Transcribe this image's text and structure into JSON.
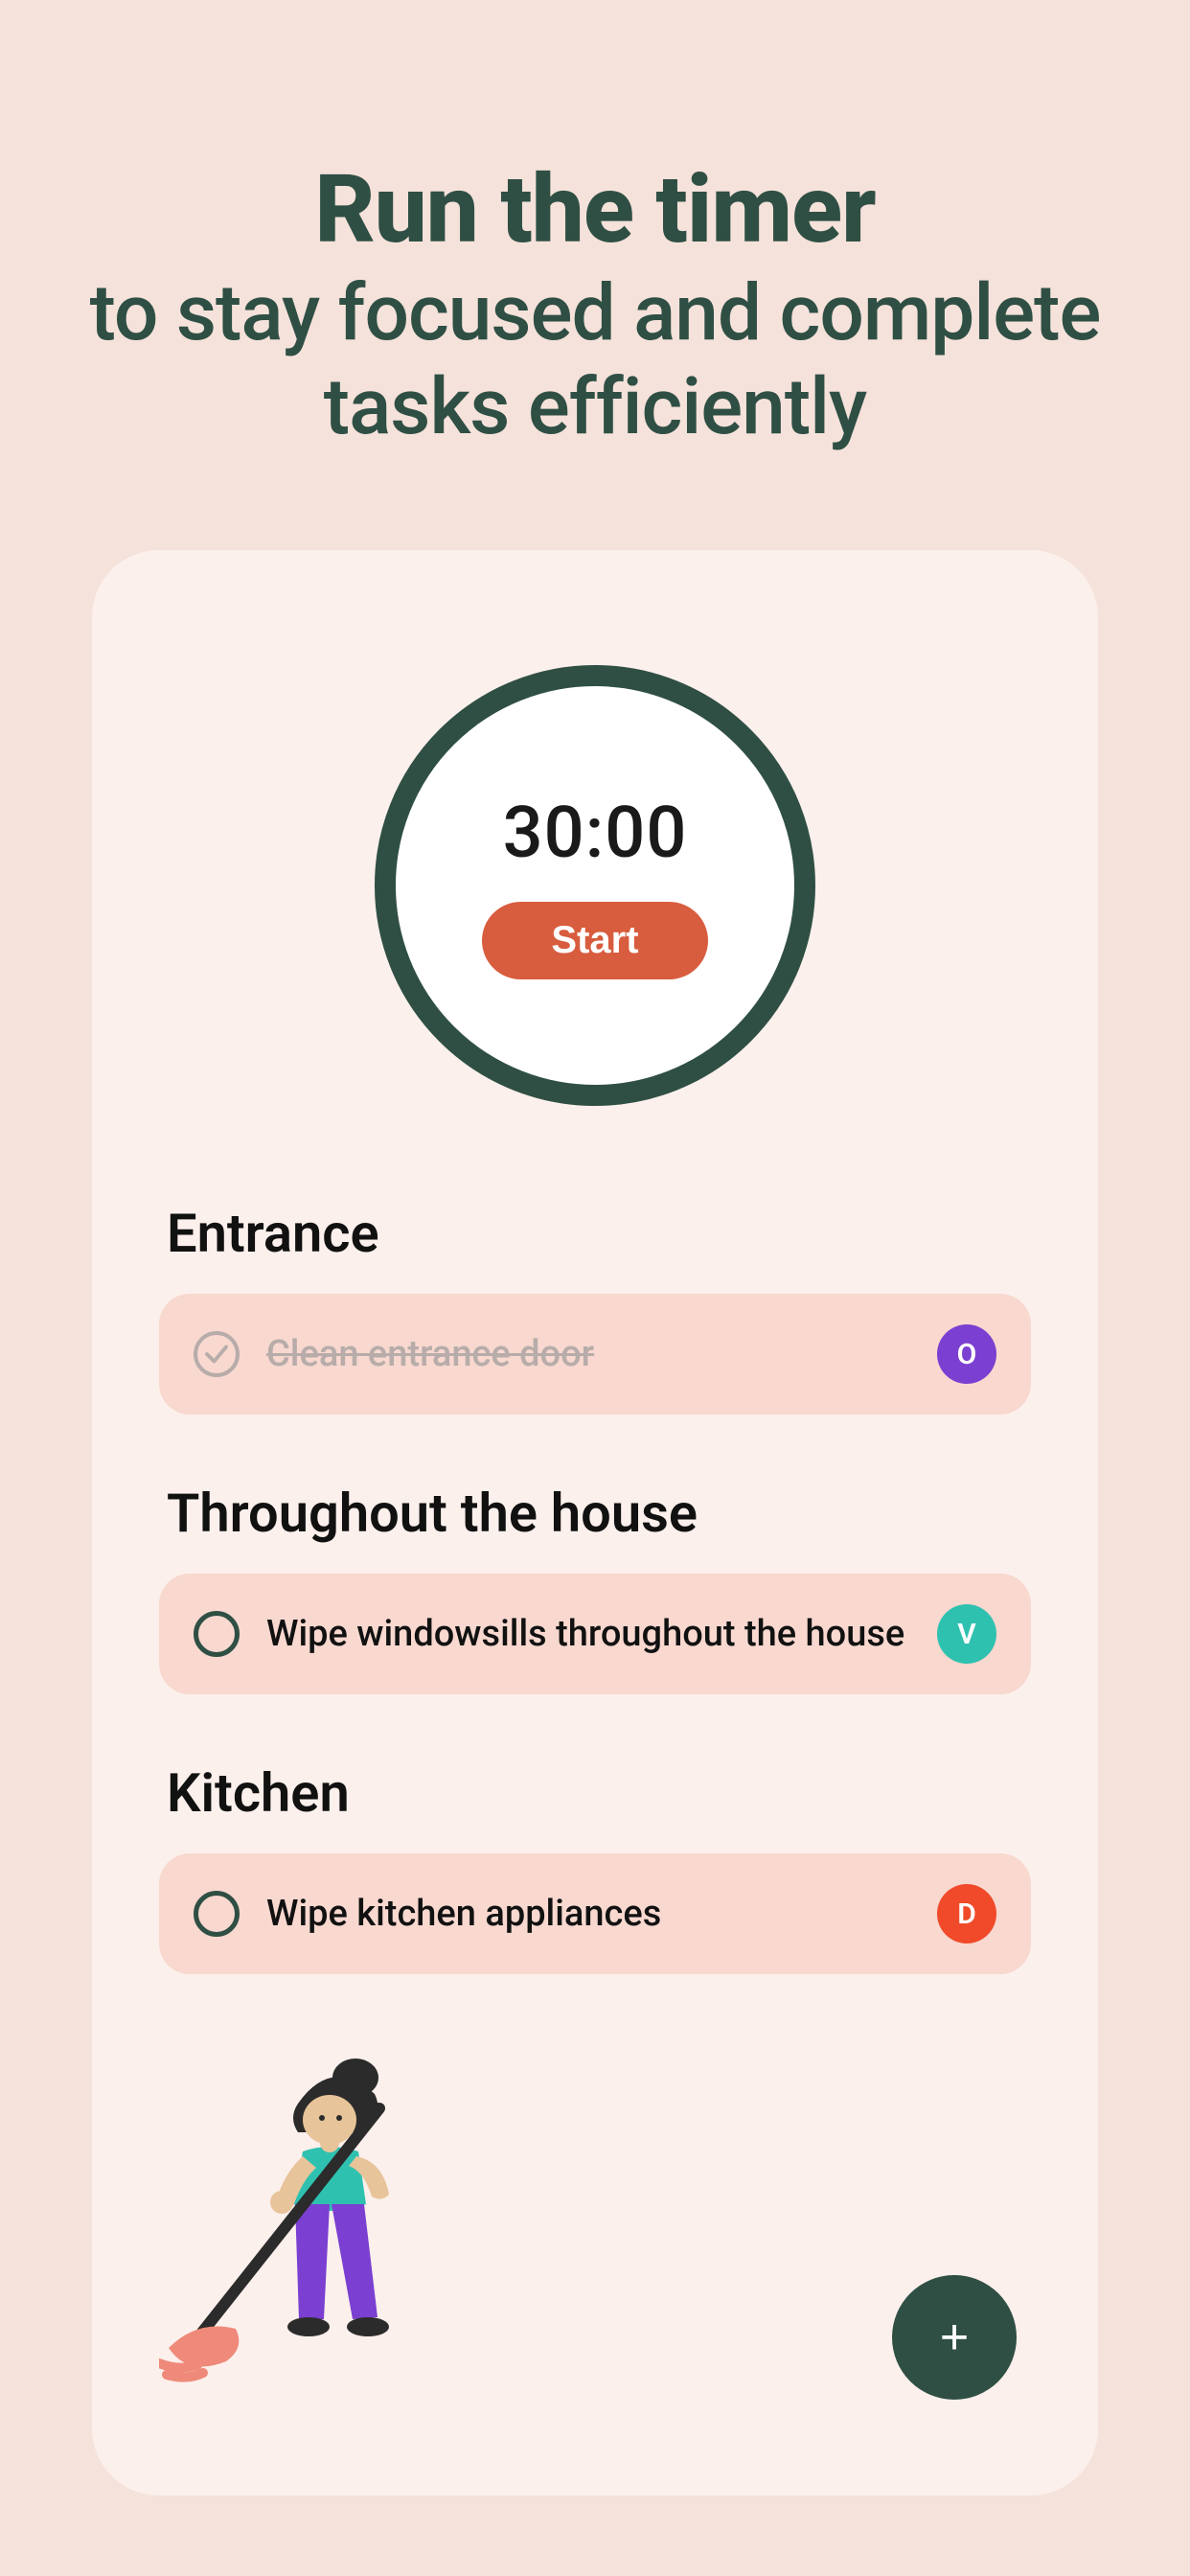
{
  "headline": {
    "bold": "Run the timer",
    "rest": "to stay focused and complete tasks efficiently"
  },
  "timer": {
    "time": "30:00",
    "start_label": "Start"
  },
  "sections": [
    {
      "title": "Entrance",
      "task": {
        "label": "Clean entrance door",
        "done": true
      },
      "avatar": {
        "initial": "O",
        "color": "#7b3fd1"
      }
    },
    {
      "title": "Throughout the house",
      "task": {
        "label": "Wipe windowsills throughout the house",
        "done": false
      },
      "avatar": {
        "initial": "V",
        "color": "#2fc1b0"
      }
    },
    {
      "title": "Kitchen",
      "task": {
        "label": "Wipe kitchen appliances",
        "done": false
      },
      "avatar": {
        "initial": "D",
        "color": "#f04a2a"
      }
    }
  ],
  "fab": {
    "label": "+"
  }
}
